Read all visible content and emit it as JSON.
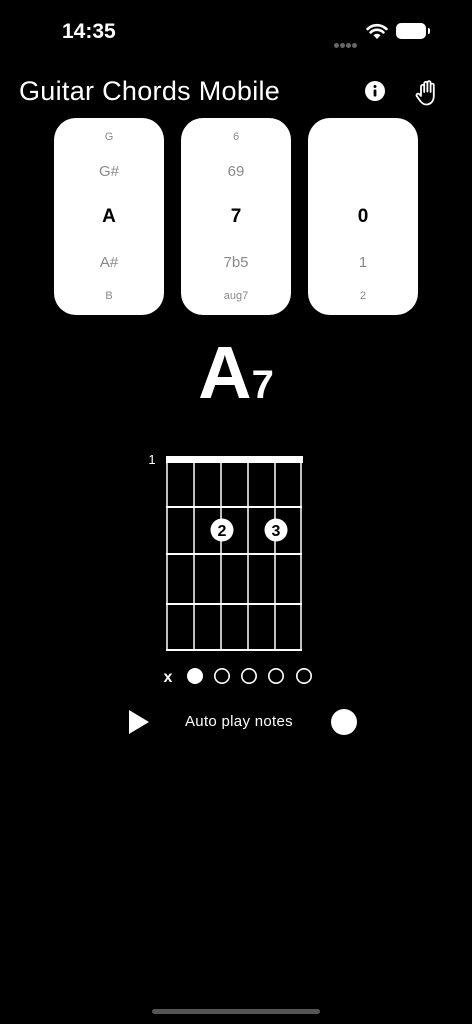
{
  "status": {
    "time": "14:35"
  },
  "header": {
    "title": "Guitar Chords Mobile"
  },
  "pickers": {
    "root": {
      "far_above": "G",
      "above": "G#",
      "selected": "A",
      "below": "A#",
      "far_below": "B"
    },
    "quality": {
      "far_above": "6",
      "above": "69",
      "selected": "7",
      "below": "7b5",
      "far_below": "aug7"
    },
    "variation": {
      "far_above": "",
      "above": "",
      "selected": "0",
      "below": "1",
      "far_below": "2"
    }
  },
  "chord": {
    "root": "A",
    "quality": "7"
  },
  "fretboard": {
    "start_fret": "1",
    "fingers": [
      {
        "string": 3,
        "fret": 2,
        "label": "2"
      },
      {
        "string": 5,
        "fret": 2,
        "label": "3"
      }
    ],
    "string_states": [
      "x",
      "root",
      "open",
      "open",
      "open",
      "open"
    ]
  },
  "playback": {
    "auto_play_label": "Auto play notes",
    "auto_play_enabled": true
  },
  "icons": [
    "wifi-icon",
    "battery-icon",
    "info-icon",
    "hand-icon",
    "play-icon"
  ]
}
